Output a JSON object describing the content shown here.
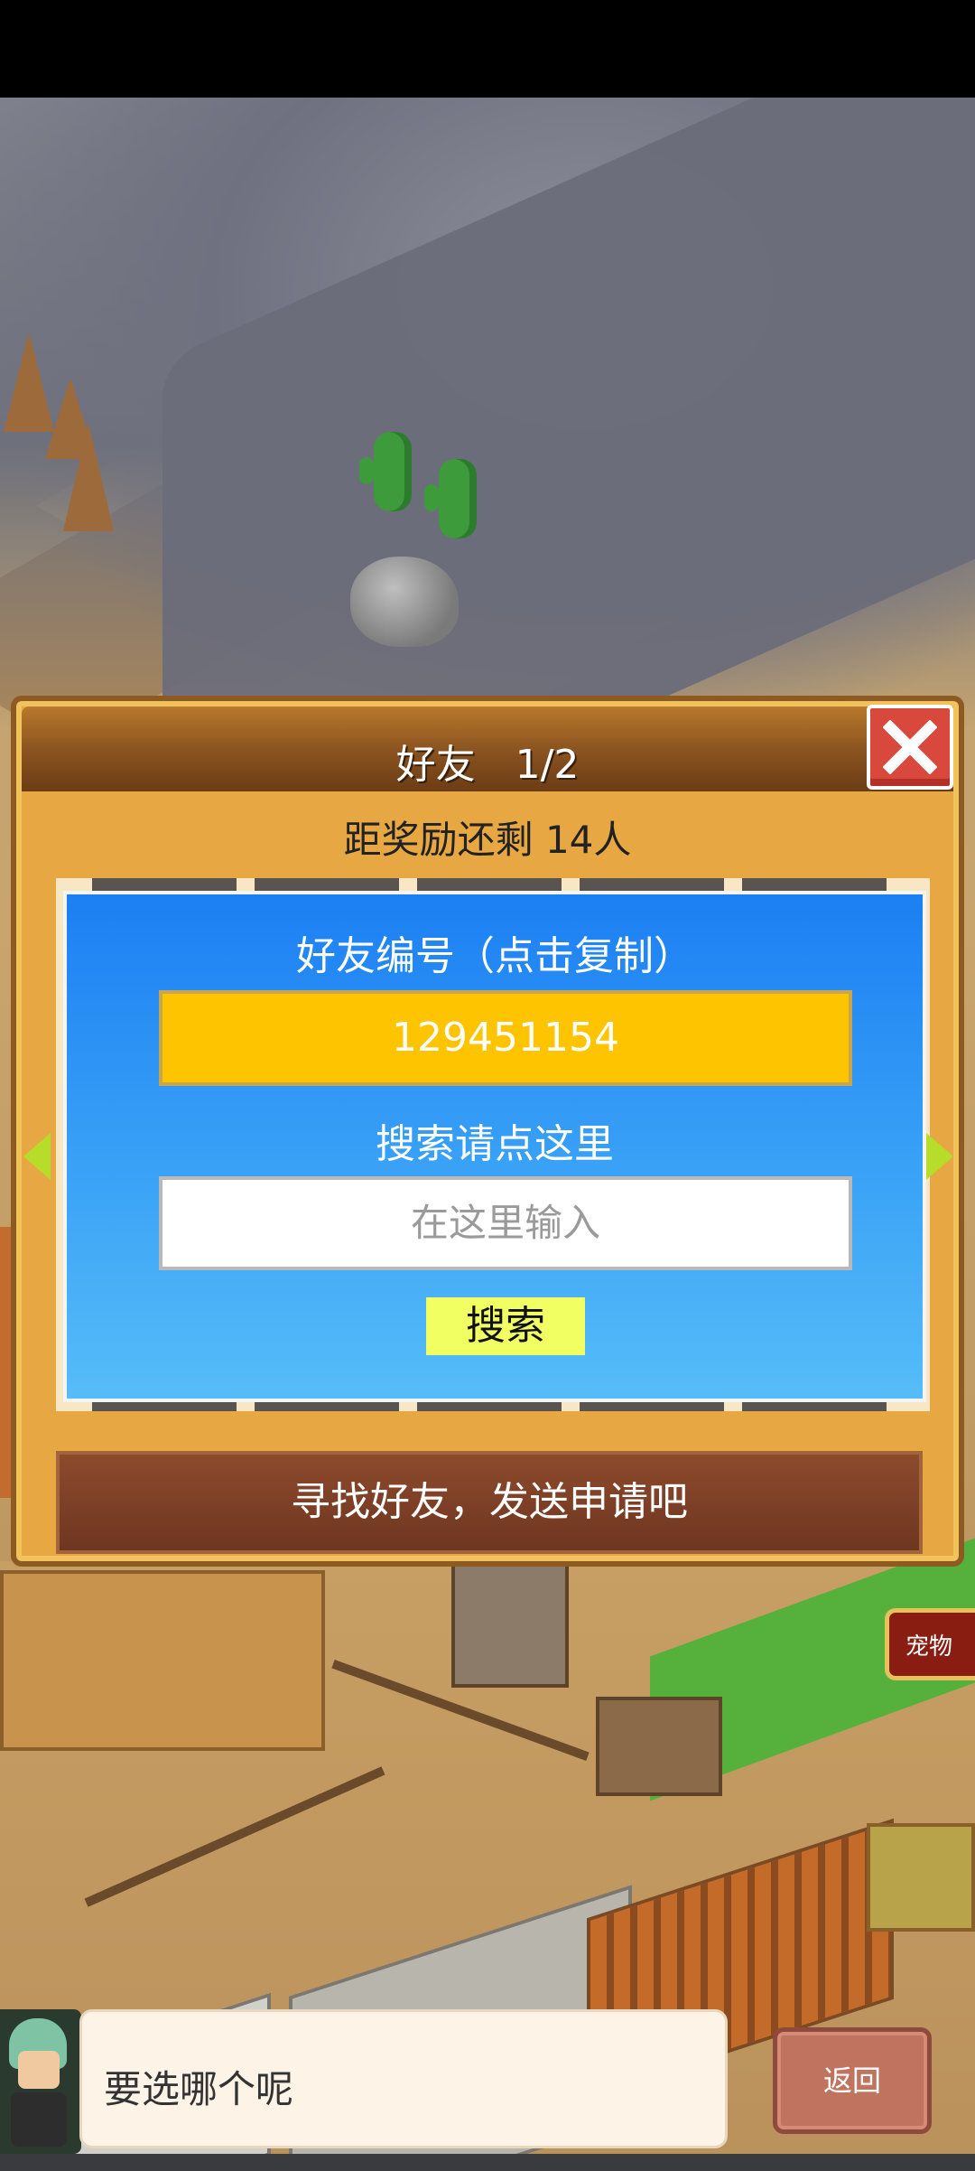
{
  "dialog": {
    "title": "好友　1/2",
    "reward_text": "距奖励还剩 14人",
    "friend_id_label": "好友编号（点击复制）",
    "friend_id": "129451154",
    "search_prompt": "搜索请点这里",
    "search_placeholder": "在这里输入",
    "search_button": "搜索",
    "find_banner": "寻找好友，发送申请吧"
  },
  "side_tab": {
    "label": "宠物"
  },
  "npc": {
    "speech": "要选哪个呢"
  },
  "back_button": {
    "label": "返回"
  },
  "colors": {
    "panel_blue": "#1c7ff3",
    "friend_id_bg": "#ffc400",
    "search_button_bg": "#f2ff62",
    "close_red": "#d9483d",
    "dialog_orange": "#e7a843"
  }
}
